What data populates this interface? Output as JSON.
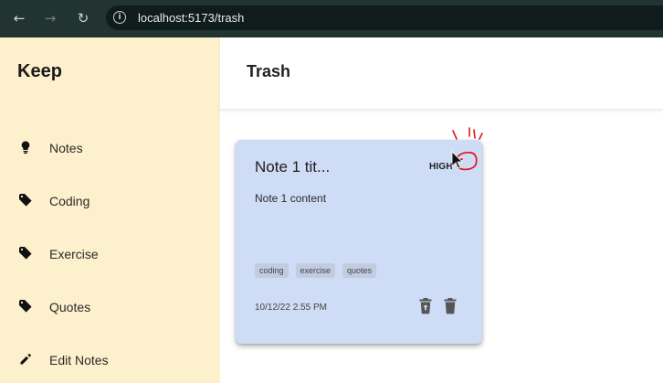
{
  "browser": {
    "url": "localhost:5173/trash",
    "icons": [
      "arrow-left-icon",
      "arrow-right-icon",
      "reload-icon",
      "info-icon"
    ]
  },
  "sidebar": {
    "logo": "Keep",
    "items": [
      {
        "label": "Notes",
        "icon": "lightbulb-icon"
      },
      {
        "label": "Coding",
        "icon": "tag-icon"
      },
      {
        "label": "Exercise",
        "icon": "tag-icon"
      },
      {
        "label": "Quotes",
        "icon": "tag-icon"
      },
      {
        "label": "Edit Notes",
        "icon": "pencil-icon"
      }
    ]
  },
  "header": {
    "title": "Trash"
  },
  "note": {
    "title": "Note 1 tit...",
    "priority": "HIGH",
    "content": "Note 1 content",
    "tags": [
      "coding",
      "exercise",
      "quotes"
    ],
    "date": "10/12/22 2.55 PM",
    "actions": [
      "restore-icon",
      "delete-forever-icon"
    ]
  },
  "colors": {
    "chrome": "#213432",
    "sidebar": "#fdf0cc",
    "card": "#cfdcf6",
    "annotation": "#e0151b"
  }
}
